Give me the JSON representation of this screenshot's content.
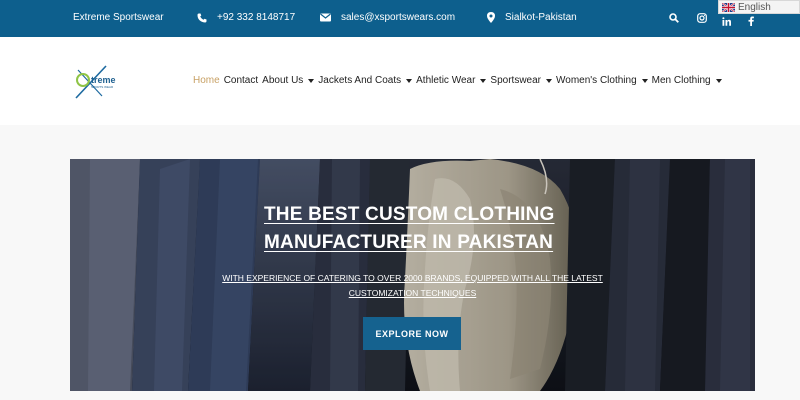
{
  "topbar": {
    "brand": "Extreme Sportswear",
    "phone": "+92 332 8148717",
    "email": "sales@xsportswears.com",
    "location": "Sialkot-Pakistan",
    "icons": [
      "phone-icon",
      "mail-icon",
      "location-pin-icon",
      "search-icon",
      "instagram-icon",
      "linkedin-icon",
      "facebook-icon"
    ],
    "language": "English",
    "bg_color": "#0d5f8d"
  },
  "logo": {
    "text": "treme",
    "letter": "X",
    "tagline": "SPORTS WEAR"
  },
  "nav": {
    "items": [
      {
        "label": "Home",
        "dropdown": false,
        "active": true
      },
      {
        "label": "Contact",
        "dropdown": false,
        "active": false
      },
      {
        "label": "About Us",
        "dropdown": true,
        "active": false
      },
      {
        "label": "Jackets And Coats",
        "dropdown": true,
        "active": false
      },
      {
        "label": "Athletic Wear",
        "dropdown": true,
        "active": false
      },
      {
        "label": "Sportswear",
        "dropdown": true,
        "active": false
      },
      {
        "label": "Women's Clothing",
        "dropdown": true,
        "active": false
      },
      {
        "label": "Men Clothing",
        "dropdown": true,
        "active": false
      }
    ],
    "active_color": "#c8a165"
  },
  "hero": {
    "title": "THE BEST CUSTOM CLOTHING MANUFACTURER IN PAKISTAN",
    "subtitle": "WITH EXPERIENCE OF CATERING TO OVER 2000 BRANDS, EQUIPPED WITH ALL THE LATEST CUSTOMIZATION TECHNIQUES",
    "button": "EXPLORE NOW",
    "button_color": "#15628f"
  }
}
